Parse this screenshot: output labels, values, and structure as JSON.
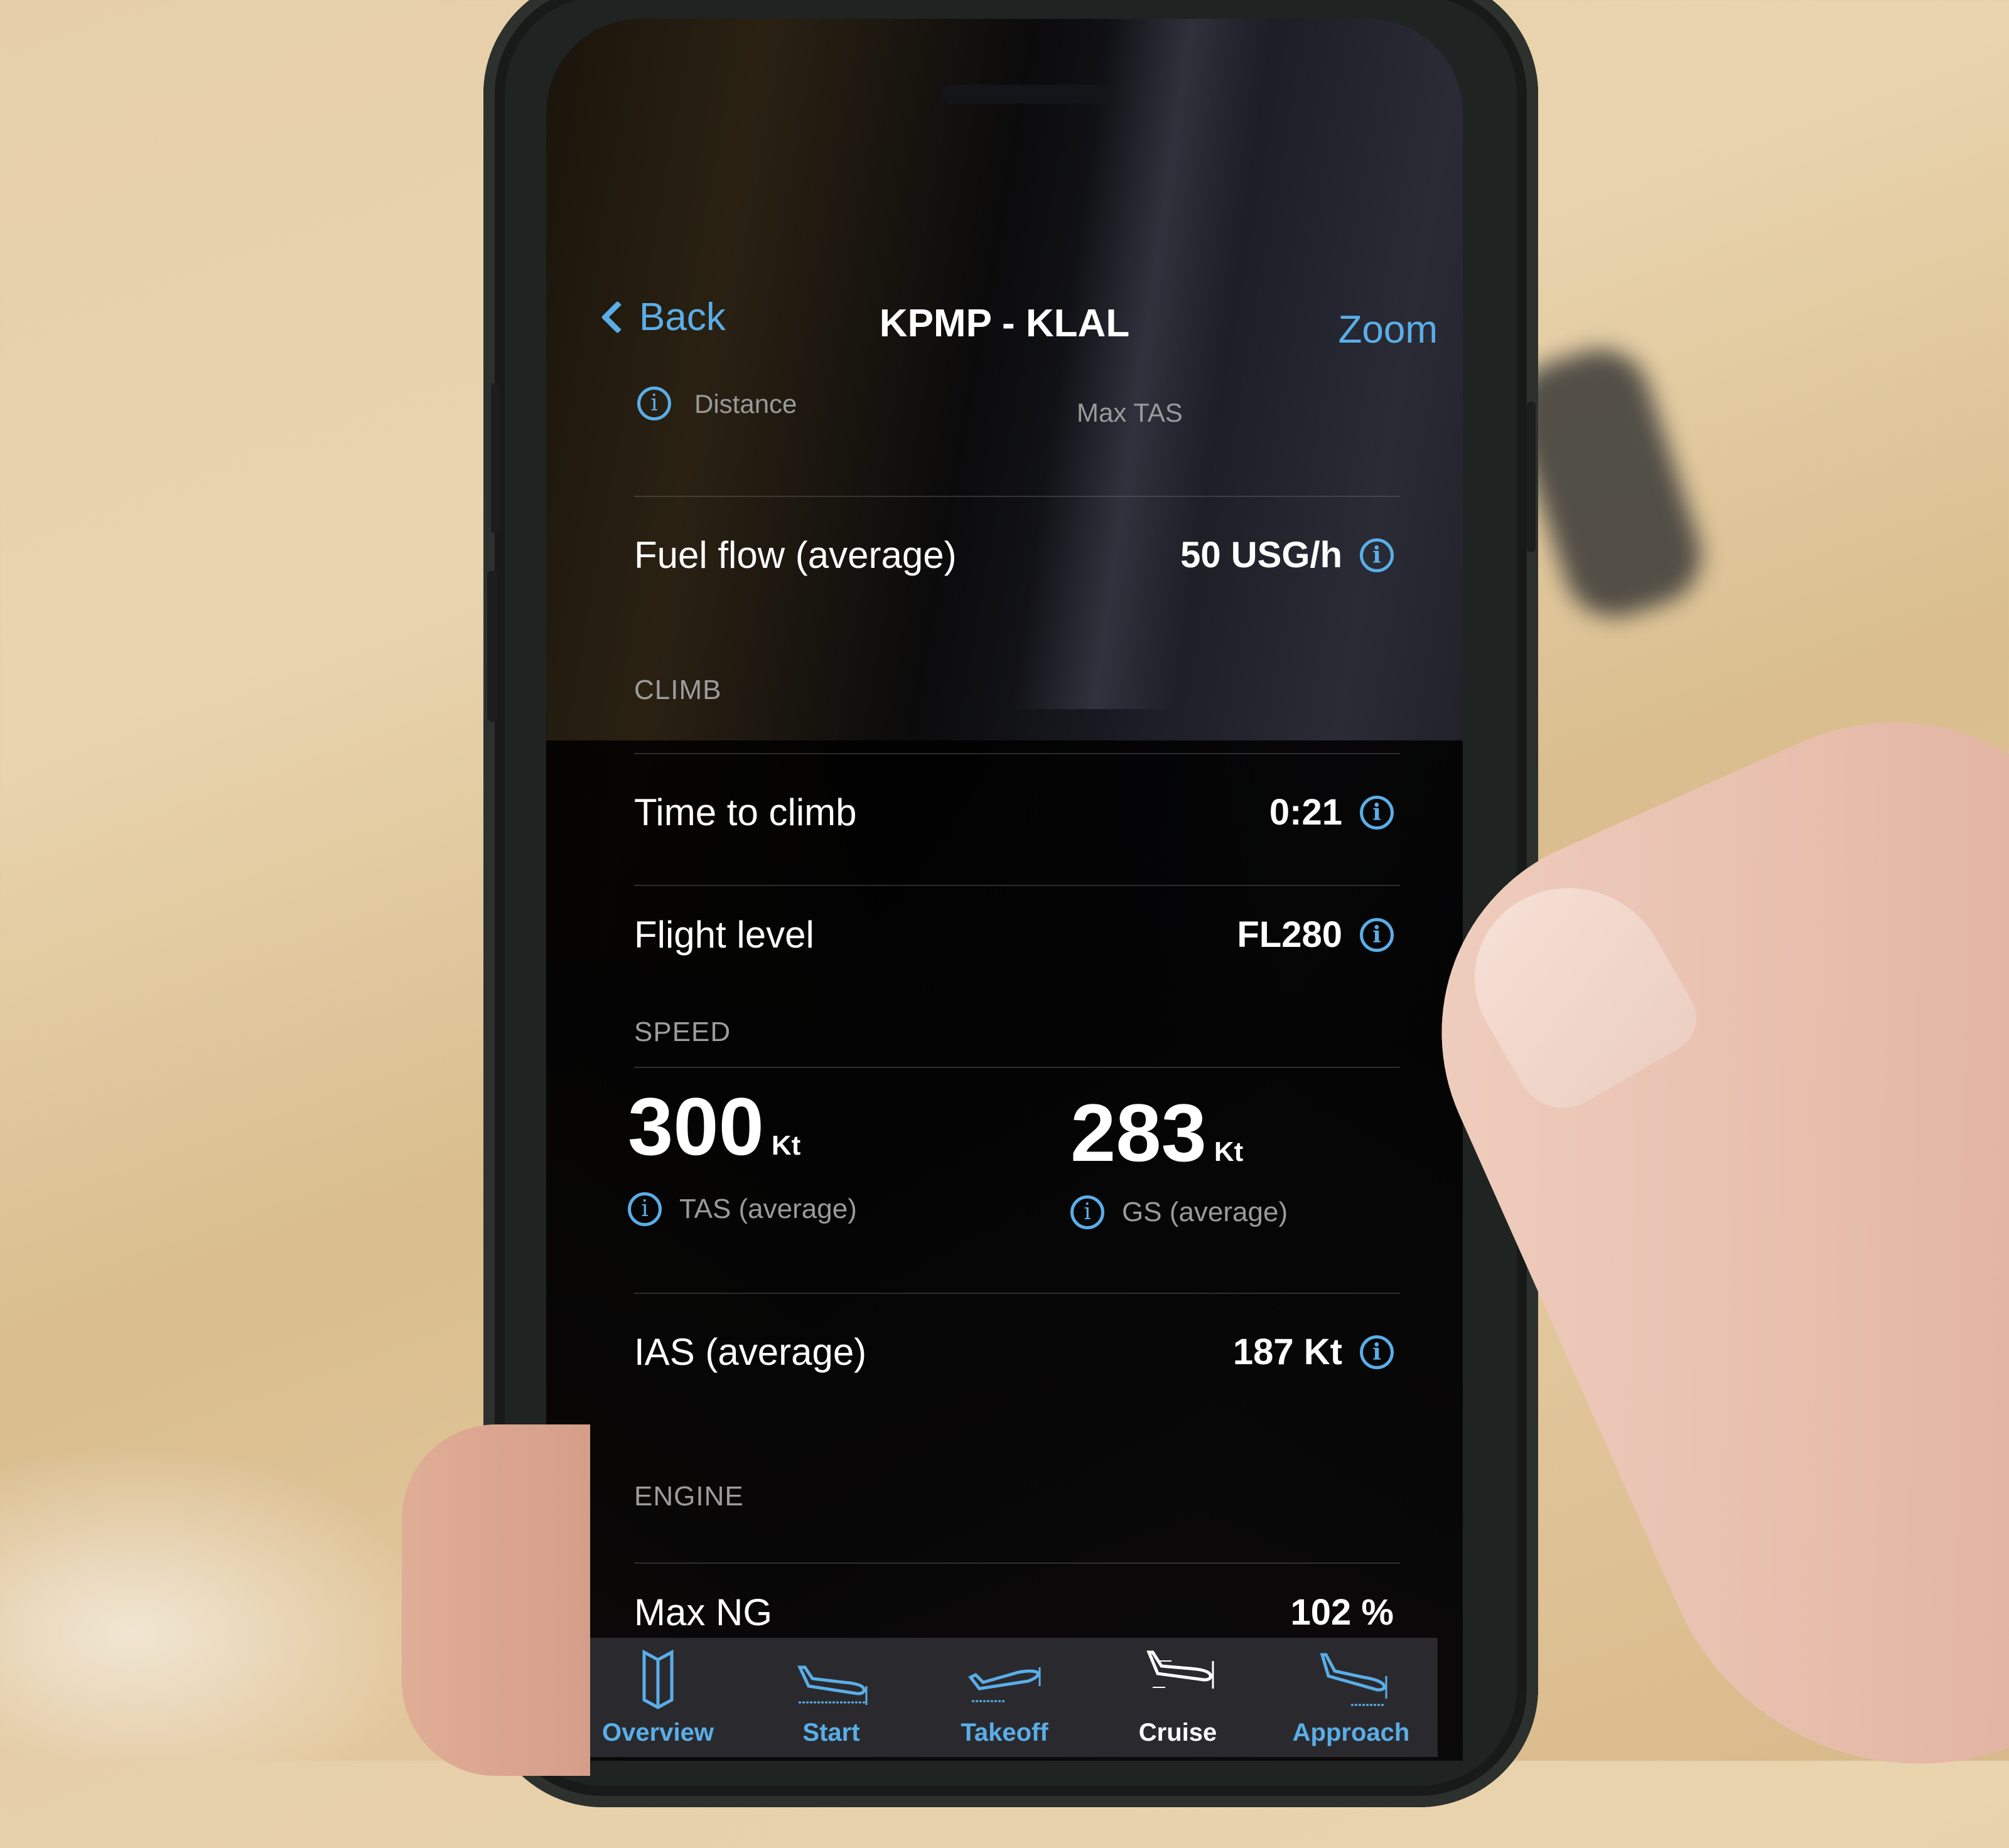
{
  "nav": {
    "back_label": "Back",
    "title": "KPMP - KLAL",
    "zoom_label": "Zoom"
  },
  "top_stats": {
    "distance_label": "Distance",
    "max_tas_label": "Max TAS"
  },
  "rows": {
    "fuel_flow": {
      "label": "Fuel flow (average)",
      "value": "50 USG/h"
    },
    "time_to_climb": {
      "label": "Time to climb",
      "value": "0:21"
    },
    "flight_level": {
      "label": "Flight level",
      "value": "FL280"
    },
    "ias": {
      "label": "IAS (average)",
      "value": "187 Kt"
    },
    "max_ng": {
      "label": "Max NG",
      "value": "102 %"
    }
  },
  "sections": {
    "climb": "CLIMB",
    "speed": "SPEED",
    "engine": "ENGINE"
  },
  "speed": {
    "tas": {
      "value": "300",
      "unit": "Kt",
      "label": "TAS (average)"
    },
    "gs": {
      "value": "283",
      "unit": "Kt",
      "label": "GS (average)"
    }
  },
  "tabs": [
    {
      "label": "Overview",
      "icon": "map-icon",
      "active": false
    },
    {
      "label": "Start",
      "icon": "plane-taxi-icon",
      "active": false
    },
    {
      "label": "Takeoff",
      "icon": "plane-takeoff-icon",
      "active": false
    },
    {
      "label": "Cruise",
      "icon": "plane-cruise-icon",
      "active": true
    },
    {
      "label": "Approach",
      "icon": "plane-approach-icon",
      "active": false
    }
  ],
  "colors": {
    "accent": "#5aaee8",
    "text": "#ffffff",
    "secondary_text": "#9a9a9a",
    "tabbar": "#2a2a2e"
  }
}
